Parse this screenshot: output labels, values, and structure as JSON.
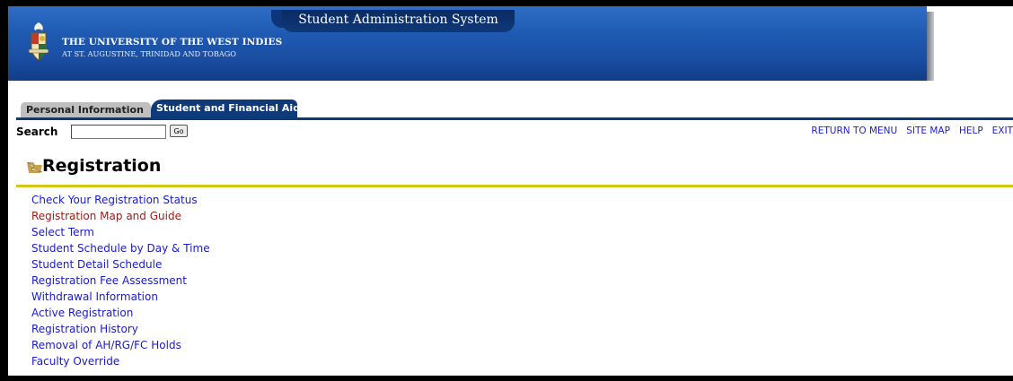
{
  "header": {
    "system_title": "Student Administration System",
    "university_name": "THE UNIVERSITY OF THE WEST INDIES",
    "university_sub": "AT ST. AUGUSTINE, TRINIDAD AND TOBAGO"
  },
  "tabs": [
    {
      "label": "Personal Information",
      "active": false
    },
    {
      "label": "Student and Financial Aid",
      "active": true
    }
  ],
  "search": {
    "label": "Search",
    "value": "",
    "button_label": "Go"
  },
  "top_links": {
    "return_to_menu": "RETURN TO MENU",
    "site_map": "SITE MAP",
    "help": "HELP",
    "exit": "EXIT"
  },
  "page": {
    "title": "Registration",
    "title_icon": "folder-arrow-icon"
  },
  "menu": {
    "items": [
      {
        "label": "Check Your Registration Status",
        "visited": false
      },
      {
        "label": "Registration Map and Guide",
        "visited": true
      },
      {
        "label": "Select Term",
        "visited": false
      },
      {
        "label": "Student Schedule by Day & Time",
        "visited": false
      },
      {
        "label": "Student Detail Schedule",
        "visited": false
      },
      {
        "label": "Registration Fee Assessment",
        "visited": false
      },
      {
        "label": "Withdrawal Information",
        "visited": false
      },
      {
        "label": "Active Registration",
        "visited": false
      },
      {
        "label": "Registration History",
        "visited": false
      },
      {
        "label": "Removal of AH/RG/FC Holds",
        "visited": false
      },
      {
        "label": "Faculty Override",
        "visited": false
      }
    ]
  },
  "colors": {
    "banner_blue": "#1a4ea3",
    "tab_active": "#0e3a7a",
    "link_blue": "#1a1acb",
    "link_visited": "#9c1a1a",
    "title_rule": "#d6c619"
  }
}
